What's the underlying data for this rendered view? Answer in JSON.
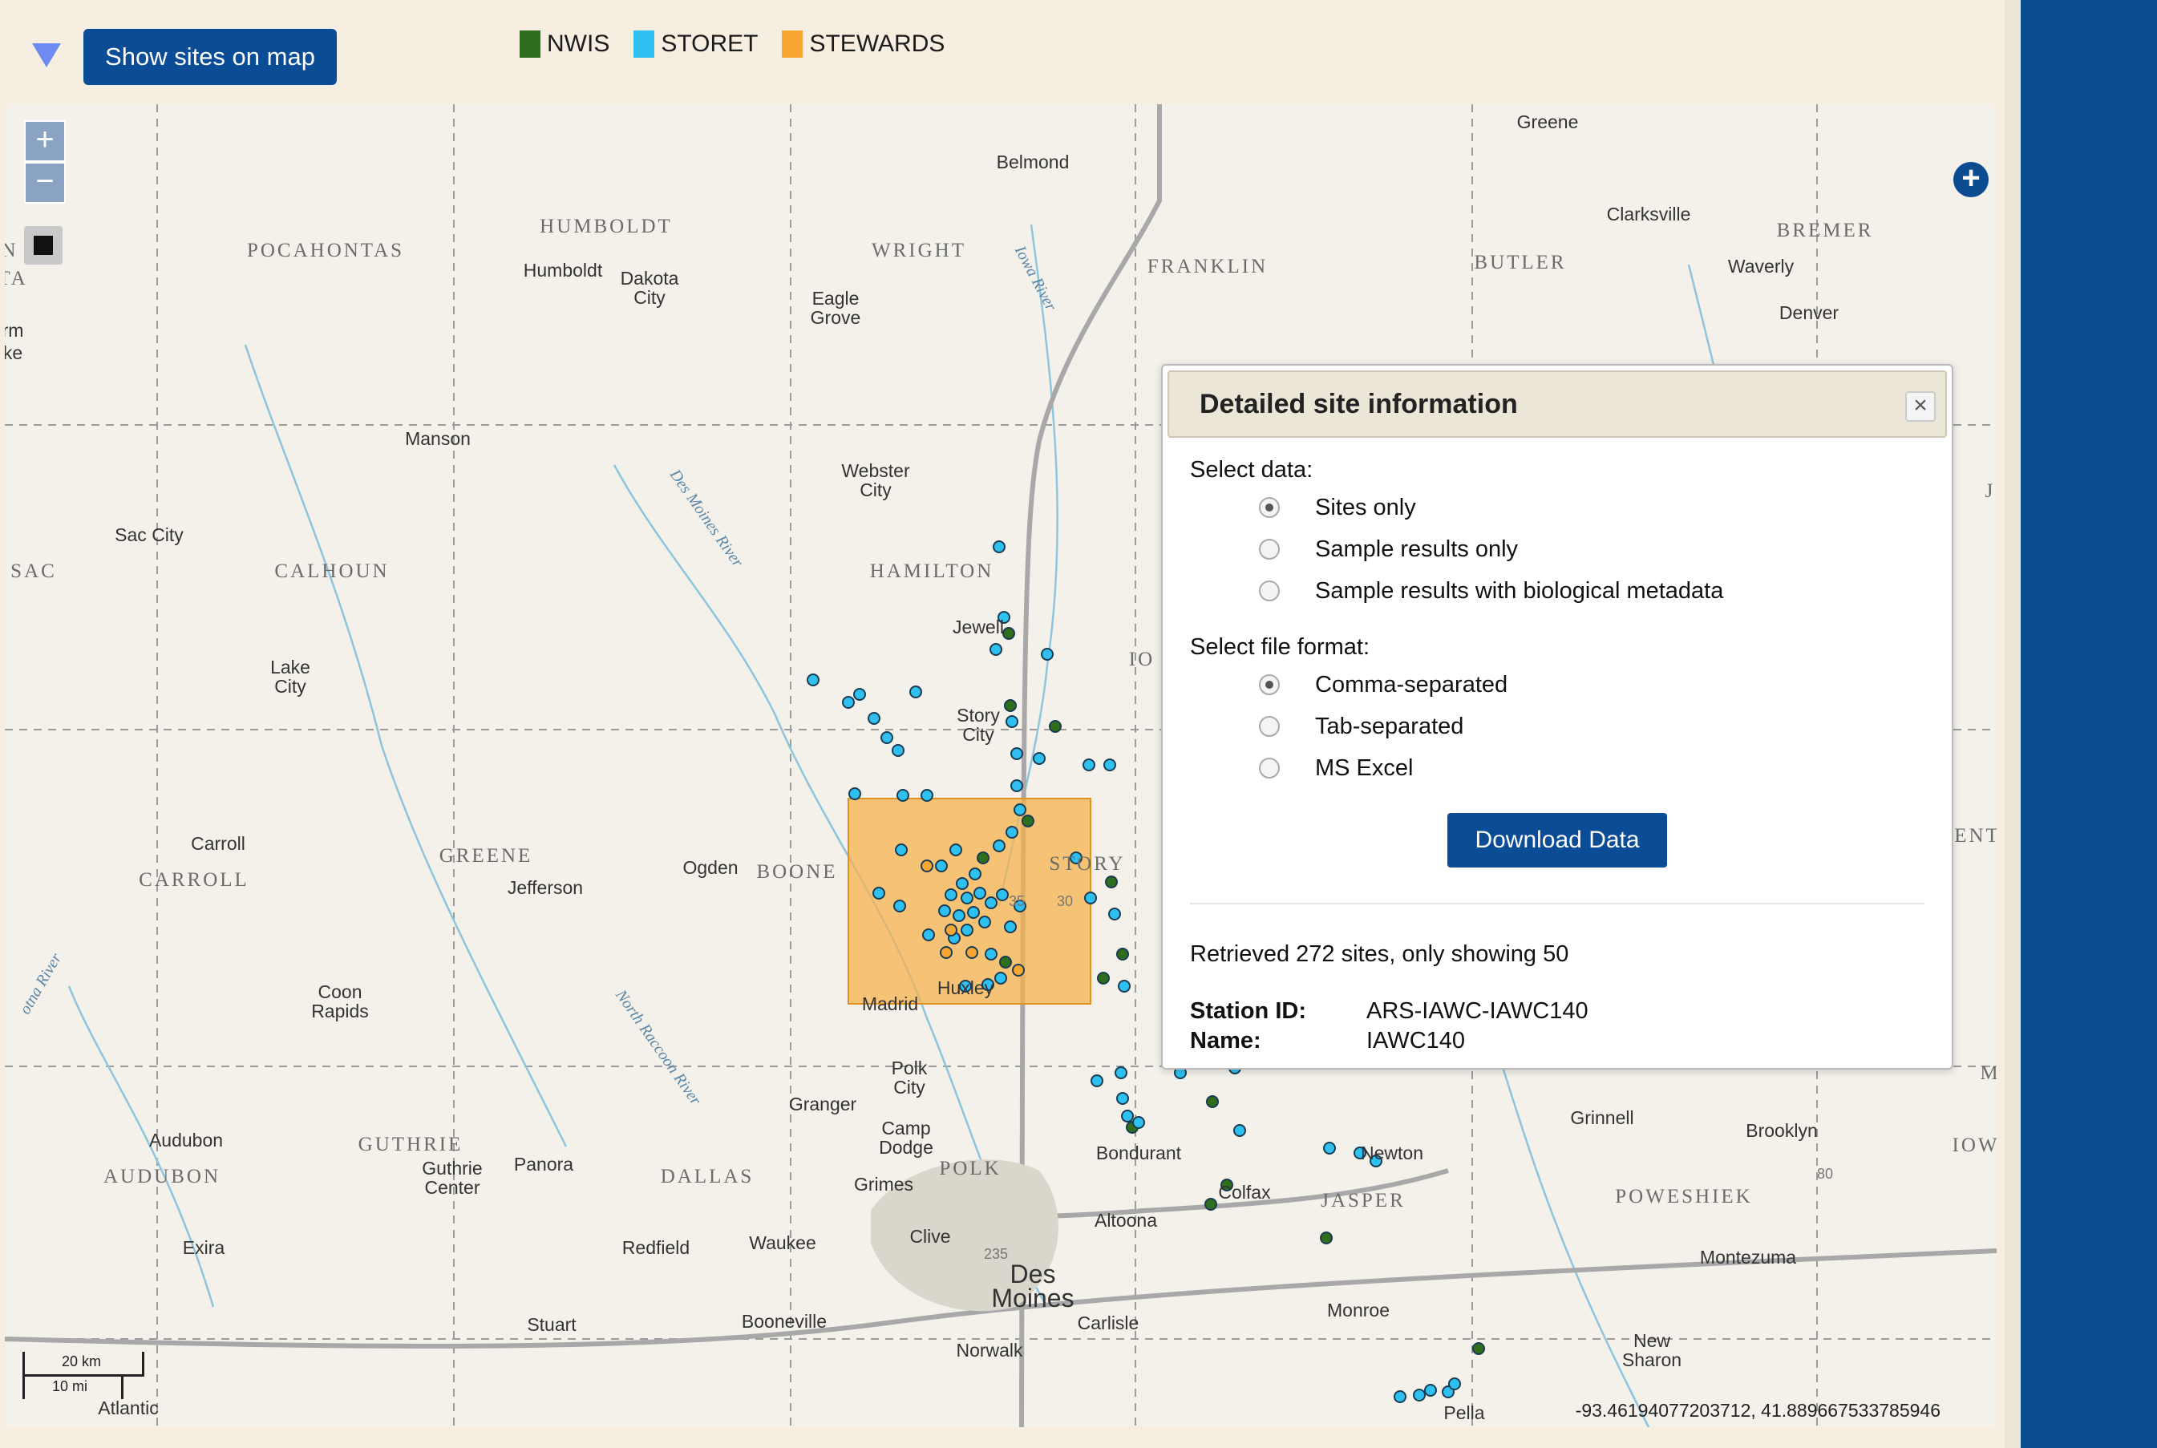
{
  "toolbar": {
    "show_sites_label": "Show sites on map",
    "legend": [
      {
        "label": "NWIS",
        "color": "#2f6e1d"
      },
      {
        "label": "STORET",
        "color": "#2fc0f2"
      },
      {
        "label": "STEWARDS",
        "color": "#f7a632"
      }
    ]
  },
  "map": {
    "zoom_in": "+",
    "zoom_out": "−",
    "add_layer": "+",
    "scale_km": "20 km",
    "scale_mi": "10 mi",
    "coordinates": "-93.46194077203712, 41.889667533785946",
    "counties": [
      "HUMBOLDT",
      "POCAHONTAS",
      "WRIGHT",
      "FRANKLIN",
      "BUTLER",
      "BREMER",
      "SAC",
      "CALHOUN",
      "HAMILTON",
      "GREENE",
      "CARROLL",
      "BOONE",
      "STORY",
      "GUTHRIE",
      "AUDUBON",
      "DALLAS",
      "POLK",
      "JASPER",
      "POWESHIEK",
      "IO",
      "ENT",
      "IOW",
      "TA",
      "N",
      "J",
      "M"
    ],
    "places": [
      "Greene",
      "Belmond",
      "Clarksville",
      "Waverly",
      "Denver",
      "Humboldt",
      "Dakota City",
      "Eagle Grove",
      "Manson",
      "Webster City",
      "Sac City",
      "Lake City",
      "Jewell",
      "Story City",
      "Carroll",
      "Jefferson",
      "Ogden",
      "Madrid",
      "Huxley",
      "Coon Rapids",
      "Polk City",
      "Granger",
      "Camp Dodge",
      "Grimes",
      "Audubon",
      "Guthrie Center",
      "Panora",
      "Bondurant",
      "Colfax",
      "Newton",
      "Grinnell",
      "Brooklyn",
      "Altoona",
      "Clive",
      "Des Moines",
      "Waukee",
      "Redfield",
      "Exira",
      "Stuart",
      "Booneville",
      "Norwalk",
      "Carlisle",
      "Monroe",
      "Montezuma",
      "New Sharon",
      "Pella",
      "Atlantic",
      "rm",
      "ke"
    ],
    "rivers": [
      "Iowa River",
      "Des Moines River",
      "North Raccoon River",
      "otna River"
    ],
    "highways": [
      "35",
      "30",
      "80",
      "235"
    ]
  },
  "dialog": {
    "title": "Detailed site information",
    "close": "×",
    "select_data_label": "Select data:",
    "data_options": [
      {
        "label": "Sites only",
        "selected": true
      },
      {
        "label": "Sample results only",
        "selected": false
      },
      {
        "label": "Sample results with biological metadata",
        "selected": false
      }
    ],
    "select_format_label": "Select file format:",
    "format_options": [
      {
        "label": "Comma-separated",
        "selected": true
      },
      {
        "label": "Tab-separated",
        "selected": false
      },
      {
        "label": "MS Excel",
        "selected": false
      }
    ],
    "download_label": "Download Data",
    "retrieved_text": "Retrieved 272 sites, only showing 50",
    "station_id_label": "Station ID:",
    "station_id_value": "ARS-IAWC-IAWC140",
    "name_label": "Name:",
    "name_value": "IAWC140"
  }
}
